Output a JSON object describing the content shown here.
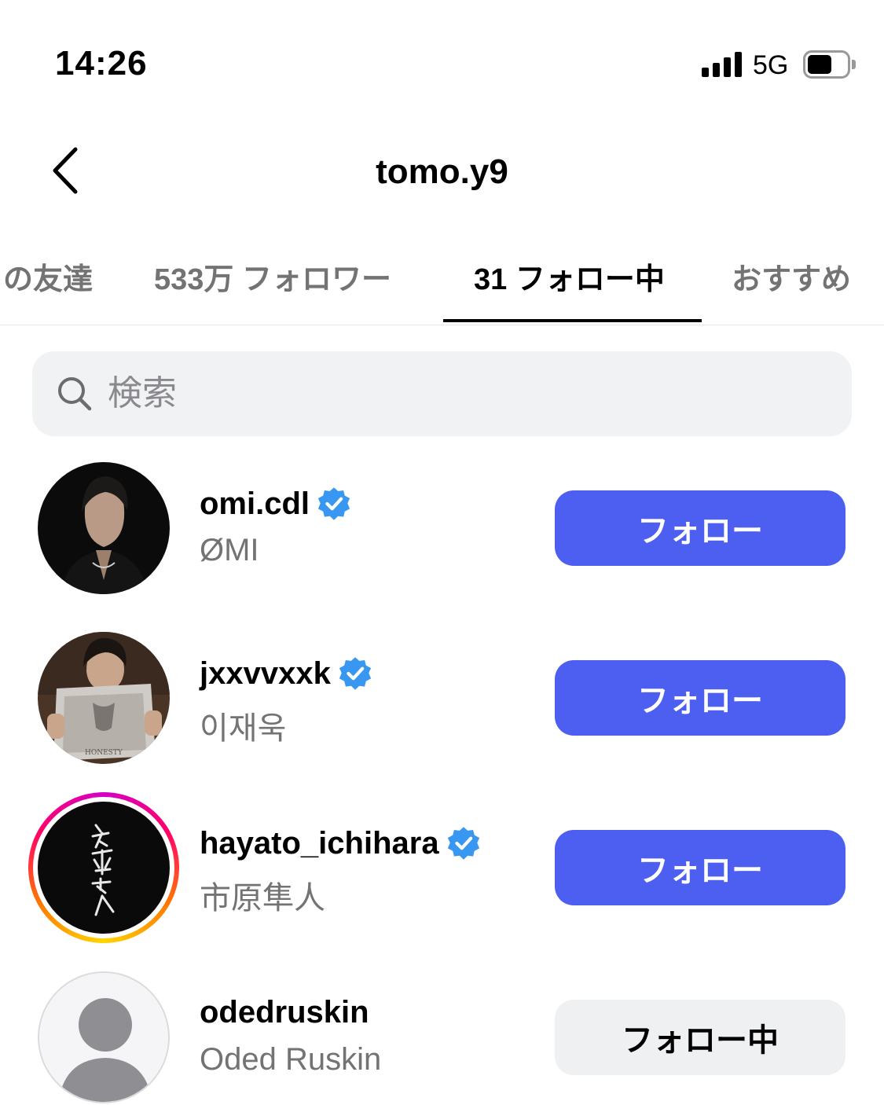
{
  "status_bar": {
    "time": "14:26",
    "network": "5G",
    "signal_icon": "cellular-signal-icon",
    "battery_icon": "battery-icon"
  },
  "header": {
    "title": "tomo.y9",
    "back_icon": "chevron-left-icon"
  },
  "tabs": [
    {
      "label": "の友達",
      "active": false
    },
    {
      "label": "533万 フォロワー",
      "active": false
    },
    {
      "label": "31 フォロー中",
      "active": true
    },
    {
      "label": "おすすめ",
      "active": false
    }
  ],
  "search": {
    "placeholder": "検索",
    "value": ""
  },
  "users": [
    {
      "username": "omi.cdl",
      "full_name": "ØMI",
      "verified": true,
      "has_story": false,
      "button_label": "フォロー",
      "following": false
    },
    {
      "username": "jxxvvxxk",
      "full_name": "이재욱",
      "verified": true,
      "has_story": false,
      "button_label": "フォロー",
      "following": false
    },
    {
      "username": "hayato_ichihara",
      "full_name": "市原隼人",
      "verified": true,
      "has_story": true,
      "button_label": "フォロー",
      "following": false
    },
    {
      "username": "odedruskin",
      "full_name": "Oded Ruskin",
      "verified": false,
      "has_story": false,
      "button_label": "フォロー中",
      "following": true
    }
  ],
  "colors": {
    "follow_button": "#4d5ff0",
    "following_button": "#eff0f2",
    "verified_badge": "#3897f0",
    "secondary_text": "#737373"
  }
}
